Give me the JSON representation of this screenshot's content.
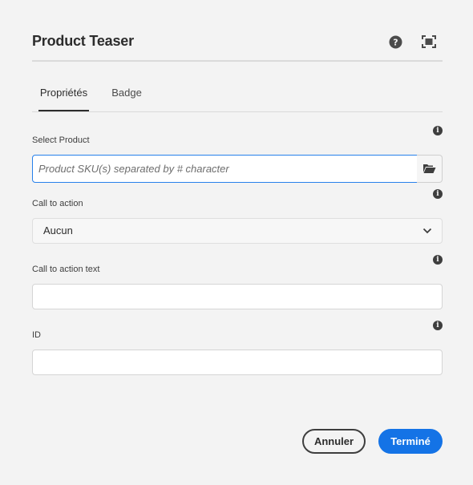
{
  "dialog": {
    "title": "Product Teaser"
  },
  "tabs": [
    {
      "label": "Propriétés",
      "active": true
    },
    {
      "label": "Badge",
      "active": false
    }
  ],
  "fields": {
    "select_product": {
      "label": "Select Product",
      "value": "",
      "placeholder": "Product SKU(s) separated by # character"
    },
    "call_to_action": {
      "label": "Call to action",
      "selected": "Aucun"
    },
    "call_to_action_text": {
      "label": "Call to action text",
      "value": ""
    },
    "id": {
      "label": "ID",
      "value": ""
    }
  },
  "info_glyph": "i",
  "footer": {
    "cancel_label": "Annuler",
    "done_label": "Terminé"
  },
  "colors": {
    "accent": "#1473e6",
    "focus_border": "#2680eb",
    "background": "#f3f3f3"
  },
  "icons": [
    "help-icon",
    "fullscreen-icon",
    "info-icon",
    "folder-open-icon",
    "chevron-down-icon"
  ]
}
